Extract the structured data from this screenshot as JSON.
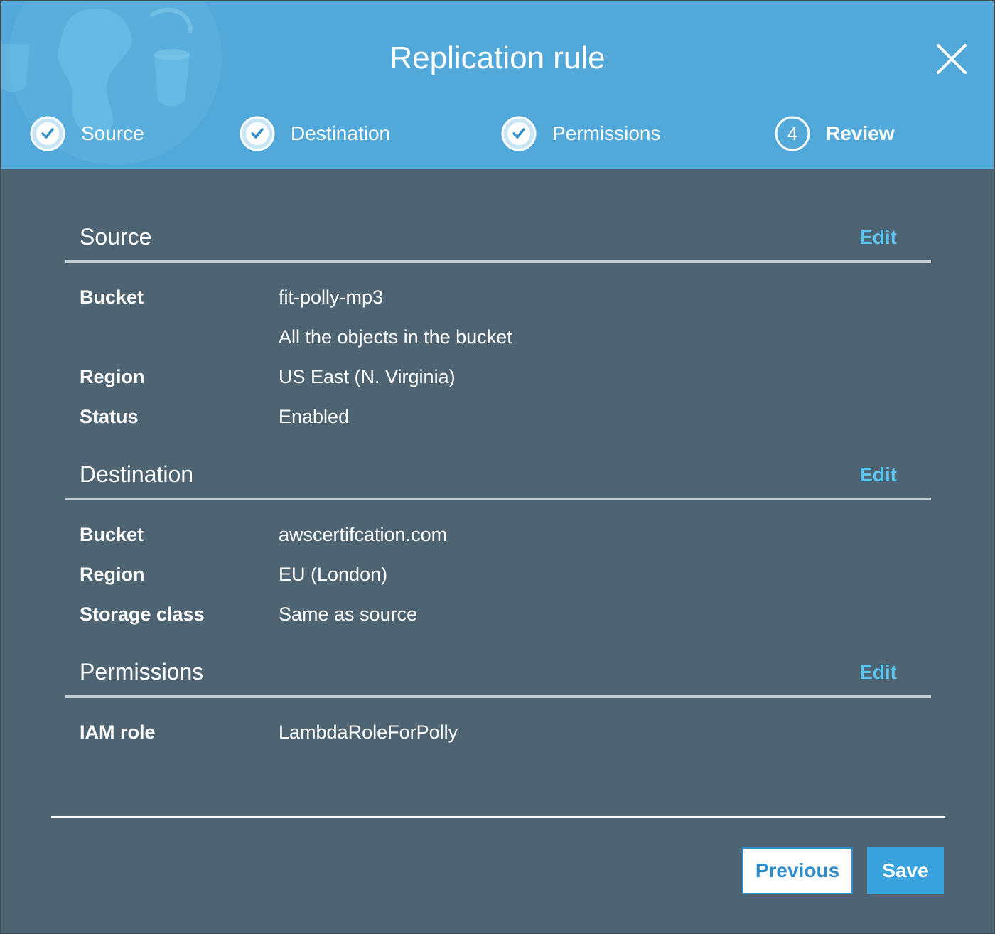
{
  "dialog": {
    "title": "Replication rule",
    "close_icon": "close-icon"
  },
  "steps": [
    {
      "label": "Source",
      "state": "completed",
      "icon": "check-circle-icon"
    },
    {
      "label": "Destination",
      "state": "completed",
      "icon": "check-circle-icon"
    },
    {
      "label": "Permissions",
      "state": "completed",
      "icon": "check-circle-icon"
    },
    {
      "label": "Review",
      "state": "current",
      "number": "4"
    }
  ],
  "sections": {
    "source": {
      "title": "Source",
      "edit_label": "Edit",
      "rows": [
        {
          "key": "Bucket",
          "value": "fit-polly-mp3"
        },
        {
          "key": "",
          "value": "All the objects in the bucket"
        },
        {
          "key": "Region",
          "value": "US East (N. Virginia)"
        },
        {
          "key": "Status",
          "value": "Enabled"
        }
      ]
    },
    "destination": {
      "title": "Destination",
      "edit_label": "Edit",
      "rows": [
        {
          "key": "Bucket",
          "value": "awscertifcation.com"
        },
        {
          "key": "Region",
          "value": "EU (London)"
        },
        {
          "key": "Storage class",
          "value": "Same as source"
        }
      ]
    },
    "permissions": {
      "title": "Permissions",
      "edit_label": "Edit",
      "rows": [
        {
          "key": "IAM role",
          "value": "LambdaRoleForPolly"
        }
      ]
    }
  },
  "footer": {
    "previous_label": "Previous",
    "save_label": "Save"
  },
  "colors": {
    "header_bg": "#52a8d8",
    "body_bg": "#4e6472",
    "edit_link": "#5cc6f2",
    "primary_button": "#3aa2dc"
  }
}
